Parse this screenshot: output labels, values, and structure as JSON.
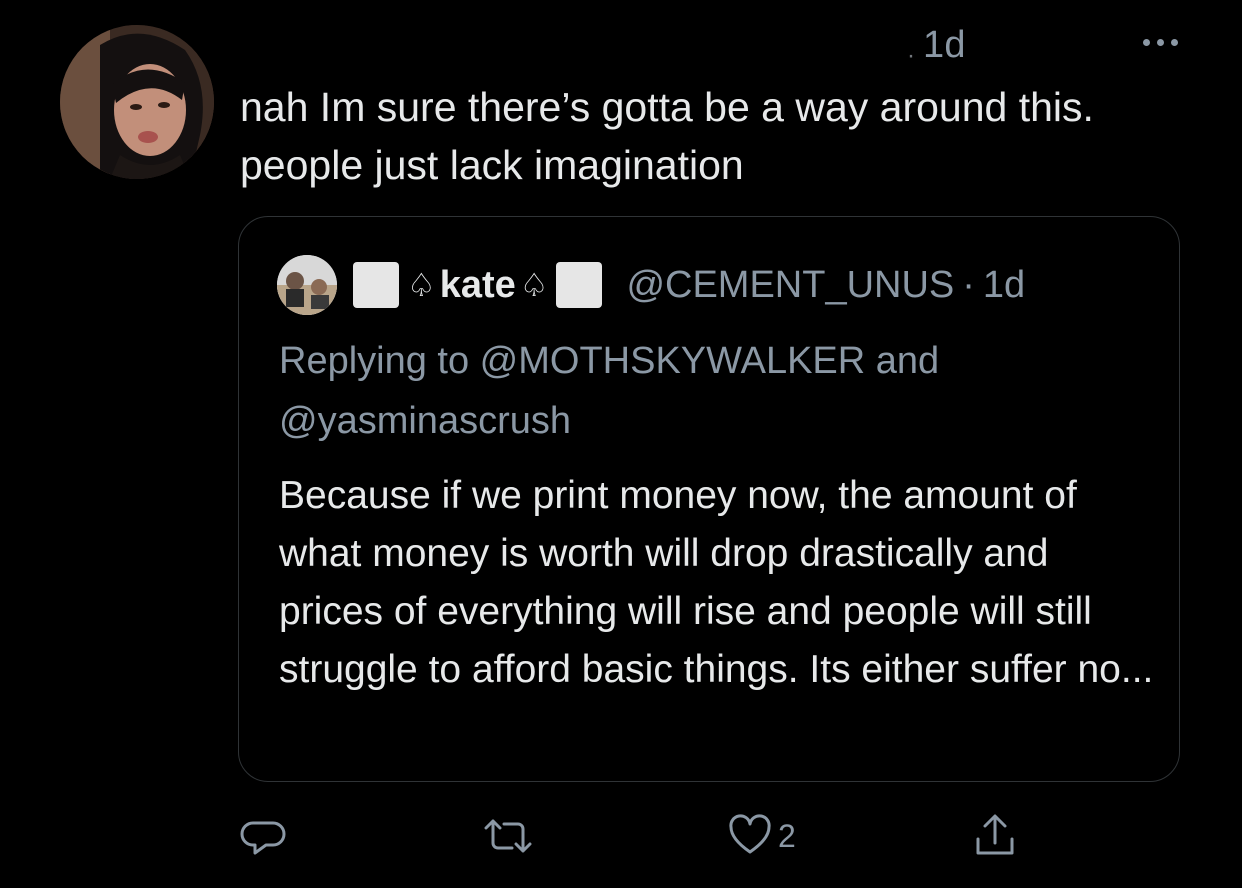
{
  "tweet": {
    "time_separator": "·",
    "time": "1d",
    "text": "nah Im sure there’s gotta be a way around this. people just lack imagination"
  },
  "quoted": {
    "name_prefix_emoji": "white-square-emoji",
    "name_spade_left": "♤",
    "name": "kate",
    "name_spade_right": "♤",
    "name_suffix_emoji": "white-square-emoji",
    "handle": "@CEMENT_UNUS",
    "separator": "·",
    "time": "1d",
    "replying_to": "Replying to @MOTHSKYWALKER and @yasminascrush",
    "text": "Because if we print money now, the amount of what money is worth will drop drastically and prices of everything will rise and people will still struggle to afford basic things. Its either suffer no..."
  },
  "actions": {
    "reply_icon": "reply-icon",
    "retweet_icon": "retweet-icon",
    "like_icon": "heart-icon",
    "like_count": "2",
    "share_icon": "share-icon"
  },
  "colors": {
    "background": "#000000",
    "primary_text": "#e7e9ea",
    "secondary_text": "#8b98a5",
    "border": "#2f3336"
  }
}
